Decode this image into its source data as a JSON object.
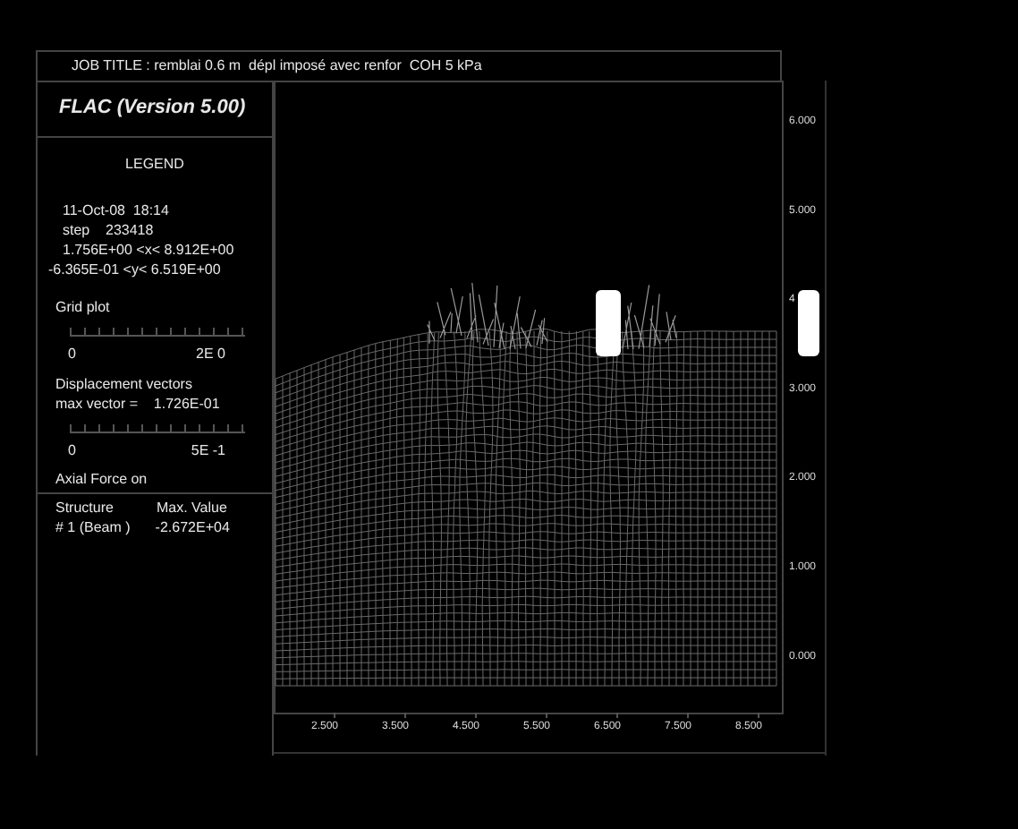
{
  "job_title": "JOB TITLE : remblai 0.6 m  dépl imposé avec renfor  COH 5 kPa",
  "program": "FLAC (Version 5.00)",
  "legend": {
    "title": "LEGEND",
    "date": "11-Oct-08  18:14",
    "step": "step    233418",
    "x_range": "1.756E+00 <x< 8.912E+00",
    "y_range": "-6.365E-01 <y< 6.519E+00"
  },
  "grid_plot": {
    "label": "Grid plot",
    "scale_start": "0",
    "scale_end": "2E 0"
  },
  "displacement": {
    "label": "Displacement vectors",
    "max": "max vector =    1.726E-01",
    "scale_start": "0",
    "scale_end": "5E -1"
  },
  "axial_force": {
    "label": "Axial Force on",
    "header": [
      "Structure",
      "Max. Value"
    ],
    "rows": [
      [
        "# 1 (Beam )",
        "-2.672E+04"
      ]
    ]
  },
  "plot": {
    "y_ticks": [
      "6.000",
      "5.000",
      "4",
      "3.000",
      "2.000",
      "1.000",
      "0.000"
    ],
    "x_ticks": [
      "2.500",
      "3.500",
      "4.500",
      "5.500",
      "6.500",
      "7.500",
      "8.500"
    ]
  }
}
